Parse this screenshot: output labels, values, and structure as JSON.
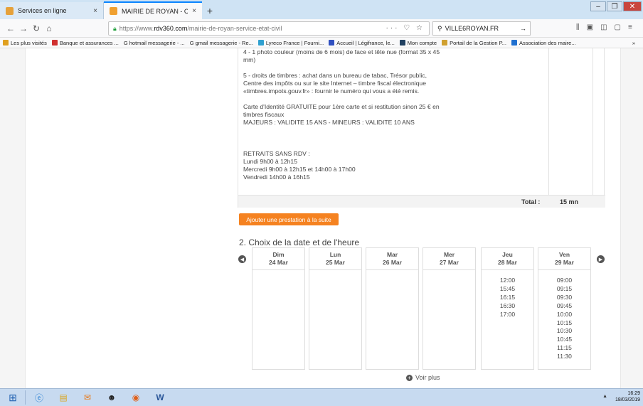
{
  "browser": {
    "tabs": [
      {
        "title": "Services en ligne",
        "close": "×",
        "active": false
      },
      {
        "title": "MAIRIE DE ROYAN - CARTE IDE",
        "close": "×",
        "active": true
      }
    ],
    "new_tab": "+",
    "url": {
      "prefix": "https://www.",
      "domain": "rdv360.com",
      "path": "/mairie-de-royan-service-etat-civil",
      "actions": "··· ♡ ☆"
    },
    "search": {
      "value": "VILLE6ROYAN.FR",
      "arrow": "→"
    },
    "bookmarks": [
      {
        "label": "Les plus visités",
        "color": "#e0a020"
      },
      {
        "label": "Banque et assurances ...",
        "color": "#d03030"
      },
      {
        "label": "G  hotmail messagerie - ...",
        "color": ""
      },
      {
        "label": "G  gmail messagerie - Re...",
        "color": ""
      },
      {
        "label": "Lyreco France | Fourni...",
        "color": "#30a0d0"
      },
      {
        "label": "Accueil | Légifrance, le...",
        "color": "#3050c0"
      },
      {
        "label": "Mon compte",
        "color": "#204060"
      },
      {
        "label": "Portail de la Gestion P...",
        "color": "#d0a030"
      },
      {
        "label": "Association des maire...",
        "color": "#2070d0"
      }
    ],
    "bookmarks_overflow": "»"
  },
  "service": {
    "description": [
      {
        "lines": [
          "4 - 1 photo couleur (moins de 6 mois) de face et tête nue (format 35 x 45",
          "mm)"
        ]
      },
      {
        "lines": [
          "5 - droits de timbres : achat dans un bureau de tabac, Trésor public,",
          "Centre des impôts ou sur le site Internet – timbre fiscal électronique",
          "«timbres.impots.gouv.fr» : fournir le numéro qui vous a été remis."
        ]
      },
      {
        "lines": [
          "Carte d'Identité GRATUITE pour 1ère carte et si restitution sinon 25 € en",
          "timbres fiscaux",
          "MAJEURS : VALIDITE 15 ANS - MINEURS : VALIDITE 10 ANS"
        ]
      },
      {
        "lines": [
          ""
        ]
      },
      {
        "lines": [
          "RETRAITS SANS RDV :",
          "Lundi 9h00 à 12h15",
          "Mercredi 9h00 à 12h15 et 14h00 à 17h00",
          "Vendredi 14h00 à 16h15"
        ]
      }
    ],
    "total_label": "Total :",
    "total_value": "15 mn"
  },
  "add_service_label": "Ajouter une prestation à la suite",
  "section_title": "2. Choix de la date et de l'heure",
  "days": [
    {
      "name": "Dim",
      "date": "24 Mar",
      "slots": []
    },
    {
      "name": "Lun",
      "date": "25 Mar",
      "slots": []
    },
    {
      "name": "Mar",
      "date": "26 Mar",
      "slots": []
    },
    {
      "name": "Mer",
      "date": "27 Mar",
      "slots": []
    },
    {
      "name": "Jeu",
      "date": "28 Mar",
      "slots": [
        "12:00",
        "15:45",
        "16:15",
        "16:30",
        "17:00"
      ]
    },
    {
      "name": "Ven",
      "date": "29 Mar",
      "slots": [
        "09:00",
        "09:15",
        "09:30",
        "09:45",
        "10:00",
        "10:15",
        "10:30",
        "10:45",
        "11:15",
        "11:30"
      ]
    }
  ],
  "voir_plus": "Voir plus",
  "taskbar": {
    "time": "16:29",
    "date": "18/03/2019"
  }
}
